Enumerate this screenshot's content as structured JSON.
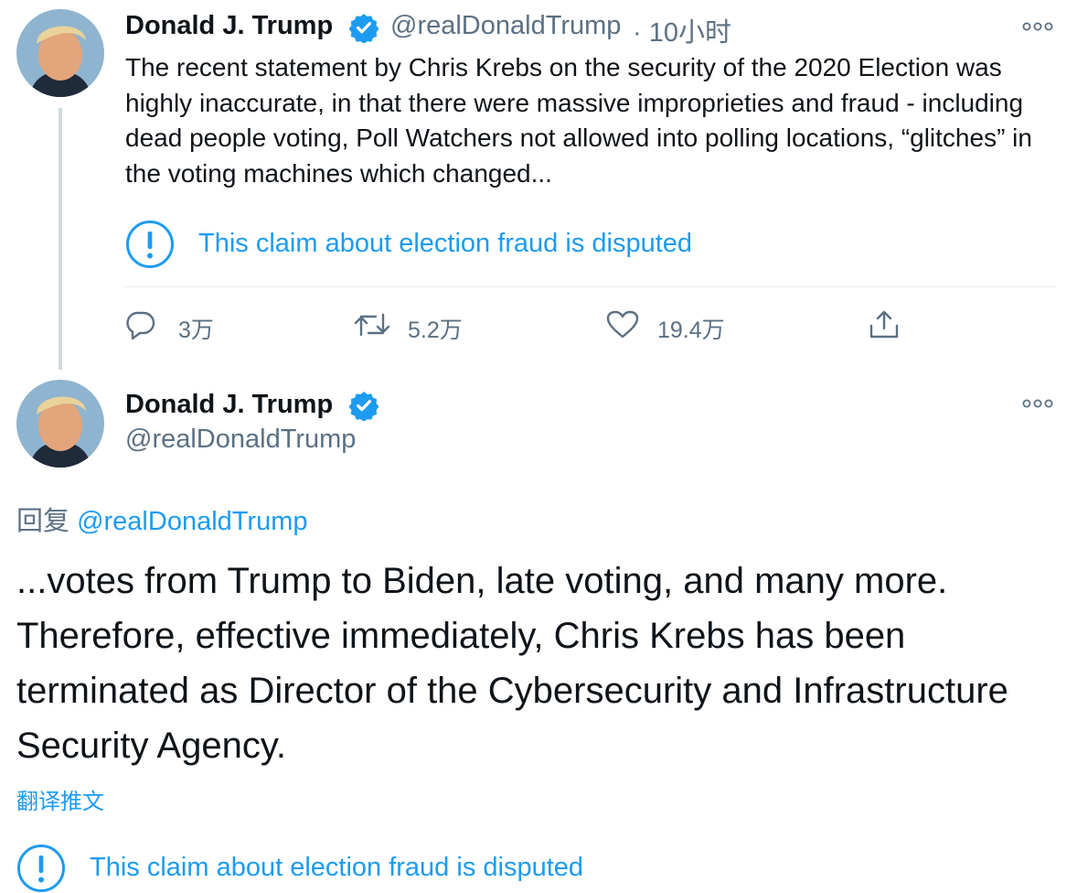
{
  "colors": {
    "accent": "#1d9bf0",
    "muted": "#5b7083",
    "text": "#0f1419"
  },
  "tweet1": {
    "name": "Donald J. Trump",
    "handle": "@realDonaldTrump",
    "time": "· 10小时",
    "text": "The recent statement by Chris Krebs on the security of the 2020 Election was highly inaccurate, in that there were massive improprieties and fraud - including dead people voting, Poll Watchers not allowed into polling locations, “glitches” in the voting machines which changed...",
    "notice": "This claim about election fraud is disputed",
    "actions": {
      "replies": "3万",
      "retweets": "5.2万",
      "likes": "19.4万"
    }
  },
  "tweet2": {
    "name": "Donald J. Trump",
    "handle": "@realDonaldTrump",
    "reply_prefix": "回复",
    "reply_handle": "@realDonaldTrump",
    "text": "...votes from Trump to Biden, late voting, and many more. Therefore, effective immediately, Chris Krebs has been terminated as Director of the Cybersecurity and Infrastructure Security Agency.",
    "translate": "翻译推文",
    "notice": "This claim about election fraud is disputed"
  },
  "icons": [
    "verified-badge-icon",
    "more-icon",
    "warning-icon",
    "reply-icon",
    "retweet-icon",
    "like-icon",
    "share-icon"
  ]
}
